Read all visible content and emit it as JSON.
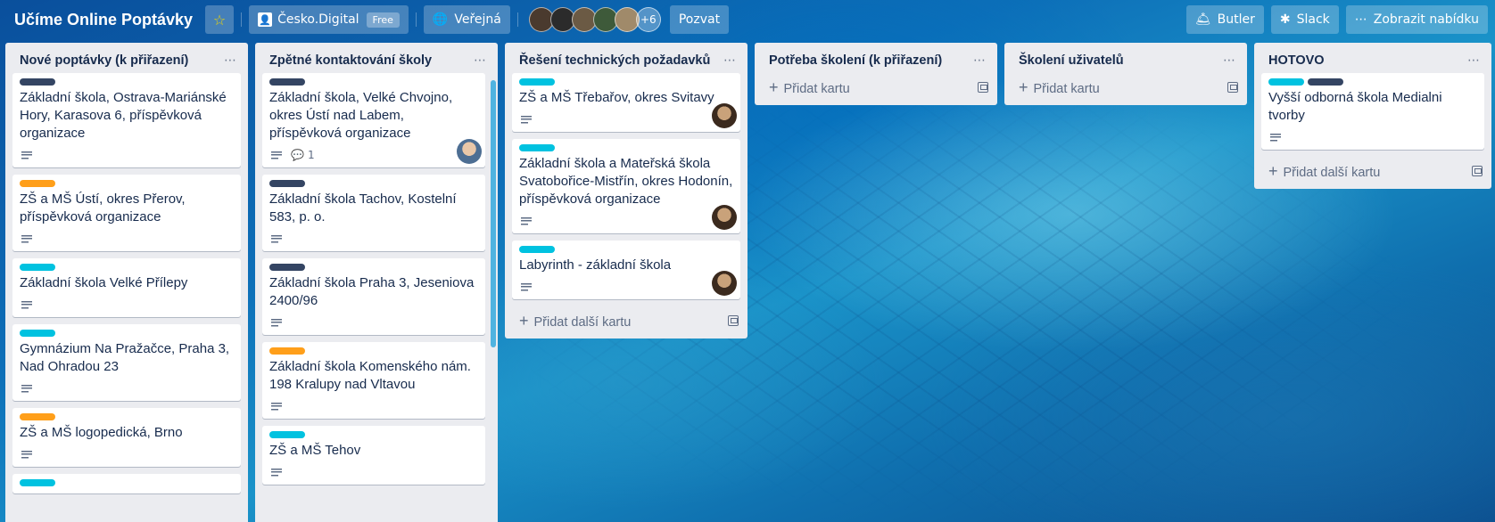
{
  "header": {
    "board_title": "Učíme Online Poptávky",
    "team_name": "Česko.Digital",
    "team_badge": "Free",
    "visibility": "Veřejná",
    "members_more": "+6",
    "invite_label": "Pozvat",
    "butler_label": "Butler",
    "slack_label": "Slack",
    "menu_label": "Zobrazit nabídku"
  },
  "colors": {
    "label_dark": "#344563",
    "label_orange": "#ff9f1a",
    "label_cyan": "#00c2e0"
  },
  "lists": [
    {
      "title": "Nové poptávky (k přiřazení)",
      "cards": [
        {
          "title": "Základní škola, Ostrava-Mariánské Hory, Karasova 6, příspěvková organizace"
        },
        {
          "title": "ZŠ a MŠ Ústí, okres Přerov, příspěvková organizace"
        },
        {
          "title": "Základní škola Velké Přílepy"
        },
        {
          "title": "Gymnázium Na Pražačce, Praha 3, Nad Ohradou 23"
        },
        {
          "title": "ZŠ a MŠ logopedická, Brno"
        }
      ]
    },
    {
      "title": "Zpětné kontaktování školy",
      "cards": [
        {
          "title": "Základní škola, Velké Chvojno, okres Ústí nad Labem, příspěvková organizace",
          "comments": "1"
        },
        {
          "title": "Základní škola Tachov, Kostelní 583, p. o."
        },
        {
          "title": "Základní škola Praha 3, Jeseniova 2400/96"
        },
        {
          "title": "Základní škola Komenského nám. 198 Kralupy nad Vltavou"
        },
        {
          "title": "ZŠ a MŠ Tehov"
        }
      ]
    },
    {
      "title": "Řešení technických požadavků",
      "cards": [
        {
          "title": "ZŠ a MŠ Třebařov, okres Svitavy"
        },
        {
          "title": "Základní škola a Mateřská škola Svatobořice-Mistřín, okres Hodonín, příspěvková organizace"
        },
        {
          "title": "Labyrinth - základní škola"
        }
      ],
      "add_label": "Přidat další kartu"
    },
    {
      "title": "Potřeba školení (k přiřazení)",
      "add_label": "Přidat kartu"
    },
    {
      "title": "Školení uživatelů",
      "add_label": "Přidat kartu"
    },
    {
      "title": "HOTOVO",
      "cards": [
        {
          "title": "Vyšší odborná škola Medialni tvorby"
        }
      ],
      "add_label": "Přidat další kartu"
    }
  ]
}
